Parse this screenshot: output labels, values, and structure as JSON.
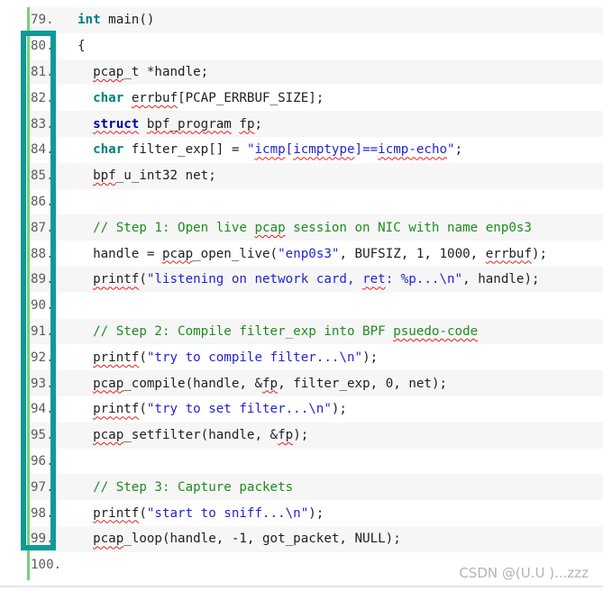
{
  "code": {
    "lines": [
      {
        "num": "79.",
        "parts": [
          {
            "t": "int",
            "c": "kw"
          },
          {
            "t": " main()",
            "c": "src"
          }
        ]
      },
      {
        "num": "80.",
        "parts": [
          {
            "t": "{",
            "c": "src"
          }
        ]
      },
      {
        "num": "81.",
        "parts": [
          {
            "t": "  ",
            "c": "src"
          },
          {
            "t": "pcap",
            "c": "src sq"
          },
          {
            "t": "_t *handle;",
            "c": "src"
          }
        ]
      },
      {
        "num": "82.",
        "parts": [
          {
            "t": "  ",
            "c": "src"
          },
          {
            "t": "char",
            "c": "kw"
          },
          {
            "t": " ",
            "c": "src"
          },
          {
            "t": "errbuf",
            "c": "src sq"
          },
          {
            "t": "[PCAP_ERRBUF_SIZE];",
            "c": "src"
          }
        ]
      },
      {
        "num": "83.",
        "parts": [
          {
            "t": "  ",
            "c": "src"
          },
          {
            "t": "struct",
            "c": "kw2 sq"
          },
          {
            "t": " ",
            "c": "src"
          },
          {
            "t": "bpf_program",
            "c": "src sq"
          },
          {
            "t": " ",
            "c": "src"
          },
          {
            "t": "fp",
            "c": "src sq"
          },
          {
            "t": ";",
            "c": "src"
          }
        ]
      },
      {
        "num": "84.",
        "parts": [
          {
            "t": "  ",
            "c": "src"
          },
          {
            "t": "char",
            "c": "kw"
          },
          {
            "t": " filter_exp[] = ",
            "c": "src"
          },
          {
            "t": "\"",
            "c": "str"
          },
          {
            "t": "icmp",
            "c": "str sq"
          },
          {
            "t": "[",
            "c": "str"
          },
          {
            "t": "icmptype",
            "c": "str sq"
          },
          {
            "t": "]==",
            "c": "str"
          },
          {
            "t": "icmp-echo",
            "c": "str sq"
          },
          {
            "t": "\"",
            "c": "str"
          },
          {
            "t": ";",
            "c": "src"
          }
        ]
      },
      {
        "num": "85.",
        "parts": [
          {
            "t": "  ",
            "c": "src"
          },
          {
            "t": "bpf",
            "c": "src sq"
          },
          {
            "t": "_u_int32 net;",
            "c": "src"
          }
        ]
      },
      {
        "num": "86.",
        "parts": []
      },
      {
        "num": "87.",
        "parts": [
          {
            "t": "  ",
            "c": "src"
          },
          {
            "t": "// Step 1: Open live ",
            "c": "cm"
          },
          {
            "t": "pcap",
            "c": "cm sq"
          },
          {
            "t": " session on NIC with name enp0s3",
            "c": "cm"
          }
        ]
      },
      {
        "num": "88.",
        "parts": [
          {
            "t": "  handle = ",
            "c": "src"
          },
          {
            "t": "pcap",
            "c": "src sq"
          },
          {
            "t": "_open_live(",
            "c": "src"
          },
          {
            "t": "\"enp0s3\"",
            "c": "str"
          },
          {
            "t": ", BUFSIZ, 1, 1000, ",
            "c": "src"
          },
          {
            "t": "errbuf",
            "c": "src sq"
          },
          {
            "t": ");",
            "c": "src"
          }
        ]
      },
      {
        "num": "89.",
        "parts": [
          {
            "t": "  ",
            "c": "src"
          },
          {
            "t": "printf",
            "c": "src sq"
          },
          {
            "t": "(",
            "c": "src"
          },
          {
            "t": "\"listening on network card, ",
            "c": "str"
          },
          {
            "t": "ret",
            "c": "str sq"
          },
          {
            "t": ": %p...\\n\"",
            "c": "str"
          },
          {
            "t": ", handle);",
            "c": "src"
          }
        ]
      },
      {
        "num": "90.",
        "parts": []
      },
      {
        "num": "91.",
        "parts": [
          {
            "t": "  ",
            "c": "src"
          },
          {
            "t": "// Step 2: Compile filter_exp into BPF ",
            "c": "cm"
          },
          {
            "t": "psuedo-code",
            "c": "cm sq"
          }
        ]
      },
      {
        "num": "92.",
        "parts": [
          {
            "t": "  ",
            "c": "src"
          },
          {
            "t": "printf",
            "c": "src sq"
          },
          {
            "t": "(",
            "c": "src"
          },
          {
            "t": "\"try to compile filter...\\n\"",
            "c": "str"
          },
          {
            "t": ");",
            "c": "src"
          }
        ]
      },
      {
        "num": "93.",
        "parts": [
          {
            "t": "  ",
            "c": "src"
          },
          {
            "t": "pcap",
            "c": "src sq"
          },
          {
            "t": "_compile(handle, &",
            "c": "src"
          },
          {
            "t": "fp",
            "c": "src sq"
          },
          {
            "t": ", filter_exp, 0, net);",
            "c": "src"
          }
        ]
      },
      {
        "num": "94.",
        "parts": [
          {
            "t": "  ",
            "c": "src"
          },
          {
            "t": "printf",
            "c": "src sq"
          },
          {
            "t": "(",
            "c": "src"
          },
          {
            "t": "\"try to set filter...\\n\"",
            "c": "str"
          },
          {
            "t": ");",
            "c": "src"
          }
        ]
      },
      {
        "num": "95.",
        "parts": [
          {
            "t": "  ",
            "c": "src"
          },
          {
            "t": "pcap",
            "c": "src sq"
          },
          {
            "t": "_setfilter(handle, &",
            "c": "src"
          },
          {
            "t": "fp",
            "c": "src sq"
          },
          {
            "t": ");",
            "c": "src"
          }
        ]
      },
      {
        "num": "96.",
        "parts": []
      },
      {
        "num": "97.",
        "parts": [
          {
            "t": "  ",
            "c": "src"
          },
          {
            "t": "// Step 3: Capture packets",
            "c": "cm"
          }
        ]
      },
      {
        "num": "98.",
        "parts": [
          {
            "t": "  ",
            "c": "src"
          },
          {
            "t": "printf",
            "c": "src sq"
          },
          {
            "t": "(",
            "c": "src"
          },
          {
            "t": "\"start to sniff...\\n\"",
            "c": "str"
          },
          {
            "t": ");",
            "c": "src"
          }
        ]
      },
      {
        "num": "99.",
        "parts": [
          {
            "t": "  ",
            "c": "src"
          },
          {
            "t": "pcap",
            "c": "src sq"
          },
          {
            "t": "_loop(handle, -1, got_packet, NULL);",
            "c": "src"
          }
        ]
      },
      {
        "num": "100.",
        "parts": []
      }
    ]
  },
  "watermark": "CSDN @(U.U )...zzz",
  "colors": {
    "highlight_box": "#0e9a96",
    "gutter_bar": "#72d572",
    "keyword": "#008080",
    "string": "#2323d4",
    "comment": "#1e8c1e"
  }
}
